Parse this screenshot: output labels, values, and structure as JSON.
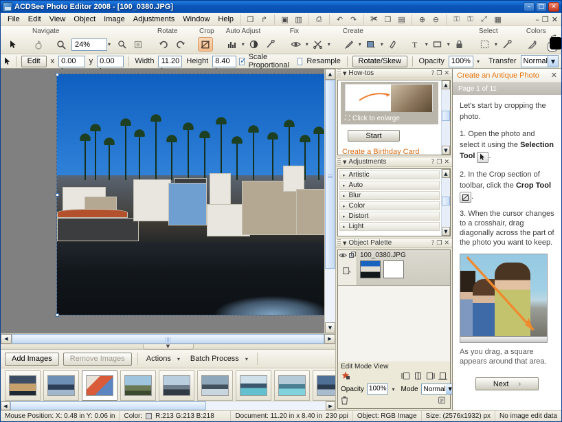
{
  "window": {
    "title": "ACDSee Photo Editor 2008 - [100_0380.JPG]",
    "minimize": "–",
    "maximize": "□",
    "close": "✕",
    "doc_minimize": "–",
    "doc_restore": "❐",
    "doc_close": "✕"
  },
  "menu": {
    "items": [
      {
        "label": "File"
      },
      {
        "label": "Edit"
      },
      {
        "label": "View"
      },
      {
        "label": "Object"
      },
      {
        "label": "Image"
      },
      {
        "label": "Adjustments"
      },
      {
        "label": "Window"
      },
      {
        "label": "Help"
      }
    ],
    "quick_icons": [
      {
        "name": "new-icon",
        "glyph": "❐"
      },
      {
        "name": "open-icon",
        "glyph": "↱"
      },
      {
        "name": "save-icon",
        "glyph": "▣"
      },
      {
        "name": "save-as-icon",
        "glyph": "▥"
      },
      {
        "name": "print-icon",
        "glyph": "⎙"
      },
      {
        "name": "undo-icon",
        "glyph": "↶"
      },
      {
        "name": "redo-icon",
        "glyph": "↷"
      },
      {
        "name": "cut-icon",
        "glyph": "✀"
      },
      {
        "name": "copy-icon",
        "glyph": "❐"
      },
      {
        "name": "paste-icon",
        "glyph": "▤"
      },
      {
        "name": "zoom-in-icon",
        "glyph": "⊕"
      },
      {
        "name": "zoom-out-icon",
        "glyph": "⊖"
      },
      {
        "name": "lock-icon",
        "glyph": "⚿"
      },
      {
        "name": "unlock-icon",
        "glyph": "⚿"
      },
      {
        "name": "fit-icon",
        "glyph": "⤢"
      },
      {
        "name": "grid-icon",
        "glyph": "▦"
      }
    ]
  },
  "toolbar": {
    "groups": [
      {
        "label": "Navigate",
        "buttons": [
          {
            "name": "pan-tool",
            "glyph": "✋",
            "state": "dim"
          },
          {
            "name": "zoom-tool",
            "glyph": "🔍",
            "state": "normal"
          }
        ],
        "zoom_value": "24%",
        "extra": [
          {
            "name": "zoom-fit",
            "glyph": "⊕"
          },
          {
            "name": "zoom-actual",
            "glyph": "▣"
          }
        ]
      },
      {
        "label": "Rotate",
        "buttons": [
          {
            "name": "rotate-left-button",
            "glyph": "↺"
          },
          {
            "name": "rotate-right-button",
            "glyph": "↻"
          }
        ]
      },
      {
        "label": "Crop",
        "buttons": [
          {
            "name": "crop-tool-button",
            "glyph": "⛶",
            "state": "pressed"
          }
        ]
      },
      {
        "label": "Auto Adjust",
        "buttons": [
          {
            "name": "auto-levels-button",
            "glyph": "📊"
          },
          {
            "name": "auto-contrast-button",
            "glyph": "◕"
          },
          {
            "name": "auto-repair-button",
            "glyph": "✎"
          }
        ]
      },
      {
        "label": "Fix",
        "buttons": [
          {
            "name": "red-eye-button",
            "glyph": "◉"
          },
          {
            "name": "blemish-remover-button",
            "glyph": "✂"
          }
        ]
      },
      {
        "label": "Create",
        "buttons": [
          {
            "name": "draw-tool-button",
            "glyph": "╱"
          },
          {
            "name": "fill-tool-button",
            "glyph": "▣"
          },
          {
            "name": "eraser-tool-button",
            "glyph": "◯"
          },
          {
            "name": "text-tool-button",
            "glyph": "T"
          },
          {
            "name": "shape-tool-button",
            "glyph": "□"
          },
          {
            "name": "lock-object-button",
            "glyph": "⚿"
          }
        ]
      },
      {
        "label": "Select",
        "buttons": [
          {
            "name": "marquee-select-button",
            "glyph": "⬚"
          },
          {
            "name": "magic-wand-button",
            "glyph": "⚒"
          }
        ]
      },
      {
        "label": "Colors",
        "buttons": [
          {
            "name": "eyedropper-button",
            "glyph": "✒"
          }
        ],
        "foreground_color": "#000000",
        "background_color": "#ffffff",
        "text_color_label": "T",
        "text_color": "#000000"
      }
    ]
  },
  "options_bar": {
    "pointer_icon": "➤",
    "edit_button": "Edit",
    "x_label": "x",
    "x_value": "0.00 in",
    "y_label": "y",
    "y_value": "0.00 in",
    "width_label": "Width",
    "width_value": "11.20 in",
    "height_label": "Height",
    "height_value": "8.40 in",
    "scale_proportional_label": "Scale Proportional",
    "scale_proportional_checked": true,
    "resample_label": "Resample",
    "resample_checked": false,
    "rotate_skew_button": "Rotate/Skew",
    "opacity_label": "Opacity",
    "opacity_value": "100%",
    "transfer_label": "Transfer",
    "transfer_value": "Normal"
  },
  "canvas": {
    "splitter_glyph": "▼",
    "hscroll_left": "◀",
    "hscroll_right": "▶",
    "vscroll_up": "▲",
    "vscroll_down": "▼"
  },
  "batch_bar": {
    "add_images": "Add Images",
    "remove_images": "Remove Images",
    "actions": "Actions",
    "actions_caret": "▾",
    "batch_process": "Batch Process",
    "batch_caret": "▾"
  },
  "filmstrip": {
    "scroll_left": "◀",
    "scroll_right": "▶",
    "thumbnails": [
      {
        "name": "thumb-1",
        "selected": false,
        "colors": [
          "#3d4d63",
          "#c7a16b",
          "#1d2834"
        ]
      },
      {
        "name": "thumb-2",
        "selected": false,
        "colors": [
          "#6d8fb5",
          "#2c3f56",
          "#9fb6cc"
        ]
      },
      {
        "name": "thumb-3",
        "selected": true,
        "colors": [
          "#e8e2d8",
          "#d95b3a",
          "#5a85c0"
        ]
      },
      {
        "name": "thumb-4",
        "selected": false,
        "colors": [
          "#9fc4de",
          "#6b7a55",
          "#3b4a2e"
        ]
      },
      {
        "name": "thumb-5",
        "selected": false,
        "colors": [
          "#b9cede",
          "#6d7d8c",
          "#2f3a45"
        ]
      },
      {
        "name": "thumb-6",
        "selected": false,
        "colors": [
          "#8fa7bb",
          "#43505e",
          "#c9d6e0"
        ]
      },
      {
        "name": "thumb-7",
        "selected": false,
        "colors": [
          "#cfe0ea",
          "#3a576e",
          "#63c0cf"
        ]
      },
      {
        "name": "thumb-8",
        "selected": false,
        "colors": [
          "#b4cad8",
          "#4d7f93",
          "#7fd3dd"
        ]
      },
      {
        "name": "thumb-9",
        "selected": false,
        "colors": [
          "#4e6f96",
          "#2c3d52",
          "#a8bccd"
        ]
      }
    ]
  },
  "panels": {
    "howtos": {
      "title": "How-tos",
      "help_glyph": "?",
      "restore_glyph": "❐",
      "close_glyph": "✕",
      "click_to_enlarge": "Click to enlarge",
      "enlarge_icon": "⛶",
      "start_button": "Start",
      "next_link": "Create a Birthday Card"
    },
    "adjustments": {
      "title": "Adjustments",
      "help_glyph": "?",
      "restore_glyph": "❐",
      "close_glyph": "✕",
      "expand_glyph": "▸",
      "items": [
        {
          "label": "Artistic"
        },
        {
          "label": "Auto"
        },
        {
          "label": "Blur"
        },
        {
          "label": "Color"
        },
        {
          "label": "Distort"
        },
        {
          "label": "Light"
        }
      ]
    },
    "object_palette": {
      "title": "Object Palette",
      "help_glyph": "?",
      "restore_glyph": "❐",
      "close_glyph": "✕",
      "layer_name": "100_0380.JPG",
      "gutter_icons": [
        {
          "name": "visibility-eye-icon",
          "glyph": "◉"
        },
        {
          "name": "link-layers-icon",
          "glyph": "⧉"
        },
        {
          "name": "layer-properties-icon",
          "glyph": "▤"
        }
      ],
      "edit_mode_view_label": "Edit Mode View",
      "edit_mode_icon": "✻",
      "align_icons": [
        {
          "name": "align-left-icon",
          "glyph": "⬚"
        },
        {
          "name": "align-center-icon",
          "glyph": "⧉"
        },
        {
          "name": "align-right-icon",
          "glyph": "⬚"
        },
        {
          "name": "align-bottom-icon",
          "glyph": "⧉"
        }
      ],
      "opacity_label": "Opacity",
      "opacity_value": "100%",
      "mode_label": "Mode",
      "mode_value": "Normal",
      "delete_icon": "🗑",
      "menu_icon": "▤"
    }
  },
  "task_pane": {
    "title": "Create an Antique Photo",
    "close_glyph": "✕",
    "page_indicator": "Page 1 of 11",
    "intro": "Let's start by cropping the photo.",
    "step1_pre": "1. Open the photo and select it using the ",
    "step1_bold": "Selection Tool",
    "step1_icon": "➤",
    "step1_post": ".",
    "step2_pre": "2. In the Crop section of toolbar, click the ",
    "step2_bold": "Crop Tool",
    "step2_icon": "⛶",
    "step2_post": ".",
    "step3": "3. When the cursor changes to a crosshair, drag diagonally across the part of the photo you want to keep.",
    "caption": "As you drag, a square appears around that area.",
    "next_button": "Next",
    "next_caret": "›"
  },
  "status_bar": {
    "mouse_position": "Mouse Position:  X: 0.48 in   Y: 0.06 in",
    "color_label": "Color:",
    "color_values": "R:213  G:213  B:218",
    "color_swatch": "#d5d5da",
    "document": "Document: 11.20 in x 8.40 in",
    "resolution": "230 ppi",
    "object": "Object: RGB Image",
    "size": "Size: (2576x1932) px",
    "edit_data": "No image edit data"
  }
}
